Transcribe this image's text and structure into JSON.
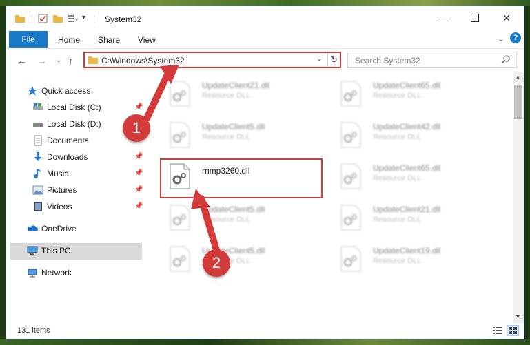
{
  "window": {
    "title": "System32"
  },
  "ribbon": {
    "tabs": [
      "File",
      "Home",
      "Share",
      "View"
    ]
  },
  "address": {
    "path": "C:\\Windows\\System32",
    "search_placeholder": "Search System32"
  },
  "sidebar": {
    "items": [
      {
        "label": "Quick access",
        "icon": "star-icon"
      },
      {
        "label": "Local Disk (C:)",
        "icon": "drive-icon",
        "pinned": true
      },
      {
        "label": "Local Disk (D:)",
        "icon": "drive-icon"
      },
      {
        "label": "Documents",
        "icon": "documents-icon"
      },
      {
        "label": "Downloads",
        "icon": "download-icon",
        "pinned": true
      },
      {
        "label": "Music",
        "icon": "music-icon",
        "pinned": true
      },
      {
        "label": "Pictures",
        "icon": "pictures-icon",
        "pinned": true
      },
      {
        "label": "Videos",
        "icon": "videos-icon",
        "pinned": true
      },
      {
        "label": "OneDrive",
        "icon": "cloud-icon"
      },
      {
        "label": "This PC",
        "icon": "computer-icon",
        "selected": true
      },
      {
        "label": "Network",
        "icon": "network-icon"
      }
    ]
  },
  "files": [
    {
      "name": "UpdateClient21.dll",
      "type": "Resource DLL"
    },
    {
      "name": "UpdateClient65.dll",
      "type": "Resource DLL"
    },
    {
      "name": "UpdateClient5.dll",
      "type": "Resource DLL"
    },
    {
      "name": "UpdateClient42.dll",
      "type": "Resource DLL"
    },
    {
      "name": "rnmp3260.dll",
      "type": ""
    },
    {
      "name": "UpdateClient65.dll",
      "type": "Resource DLL"
    },
    {
      "name": "UpdateClient5.dll",
      "type": "Resource DLL"
    },
    {
      "name": "UpdateClient21.dll",
      "type": "Resource DLL"
    },
    {
      "name": "UpdateClient5.dll",
      "type": "Resource DLL"
    },
    {
      "name": "UpdateClient19.dll",
      "type": "Resource DLL"
    }
  ],
  "status": {
    "item_count": "131 items"
  },
  "annotations": {
    "step1": "1",
    "step2": "2",
    "color": "#d33a3a"
  }
}
